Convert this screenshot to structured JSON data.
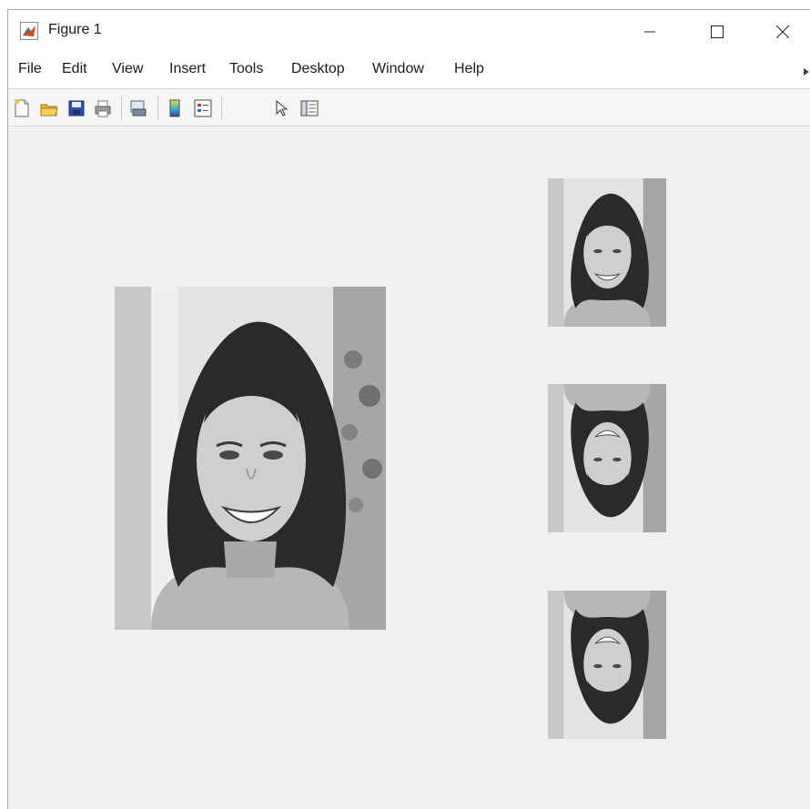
{
  "window": {
    "title": "Figure 1",
    "controls": {
      "minimize": "minimize",
      "maximize": "maximize",
      "close": "close"
    }
  },
  "menu": {
    "items": [
      "File",
      "Edit",
      "View",
      "Insert",
      "Tools",
      "Desktop",
      "Window",
      "Help"
    ]
  },
  "toolbar": {
    "icons": [
      "new-figure-icon",
      "open-file-icon",
      "save-icon",
      "print-icon",
      "print-preview-icon",
      "insert-colorbar-icon",
      "insert-legend-icon",
      "select-arrow-icon",
      "property-inspector-icon"
    ]
  },
  "images": {
    "main": "original grayscale portrait",
    "thumbnails": [
      "original",
      "vertically flipped",
      "vertically flipped"
    ]
  },
  "colors": {
    "accent": "#d24b1d",
    "canvas": "#f0f0f0"
  }
}
